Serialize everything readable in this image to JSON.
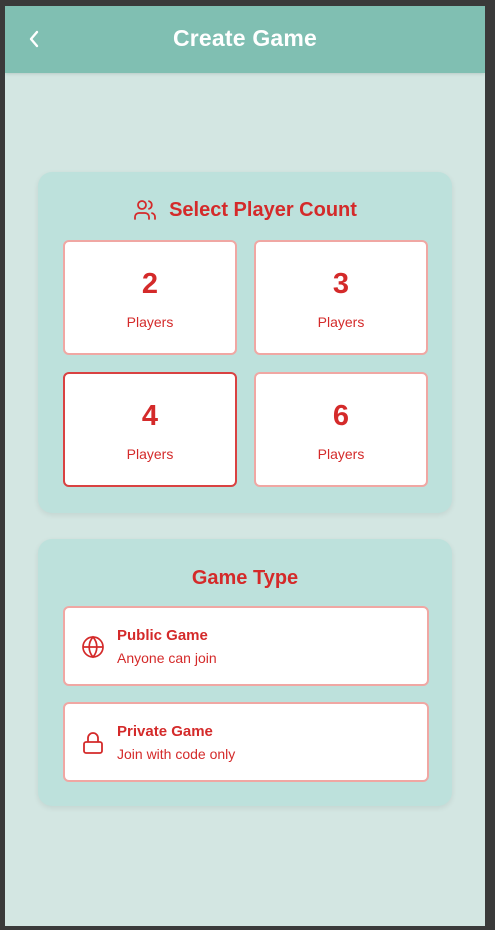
{
  "header": {
    "title": "Create Game",
    "back_icon": "chevron-left-icon"
  },
  "player_count": {
    "title": "Select Player Count",
    "icon": "users-icon",
    "options": [
      {
        "number": "2",
        "label": "Players",
        "selected": false
      },
      {
        "number": "3",
        "label": "Players",
        "selected": false
      },
      {
        "number": "4",
        "label": "Players",
        "selected": true
      },
      {
        "number": "6",
        "label": "Players",
        "selected": false
      }
    ]
  },
  "game_type": {
    "title": "Game Type",
    "options": [
      {
        "title": "Public Game",
        "description": "Anyone can join",
        "icon": "globe-icon"
      },
      {
        "title": "Private Game",
        "description": "Join with code only",
        "icon": "lock-icon"
      }
    ]
  },
  "colors": {
    "header_bg": "#80bfb2",
    "page_bg": "#d3e6e2",
    "card_bg": "#bde1dc",
    "accent_red": "#d42a2a",
    "tile_border": "#f0a7a3",
    "selected_border": "#d94242"
  }
}
